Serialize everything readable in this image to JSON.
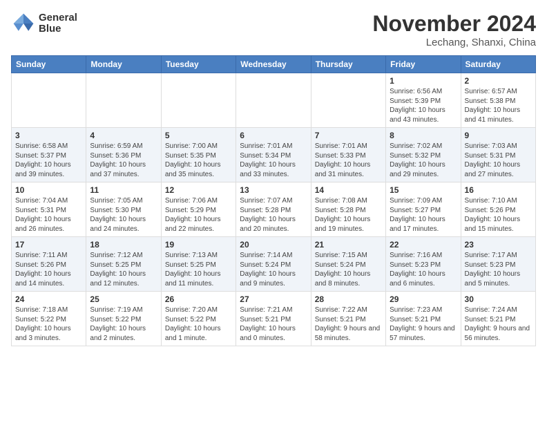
{
  "header": {
    "logo_line1": "General",
    "logo_line2": "Blue",
    "month": "November 2024",
    "location": "Lechang, Shanxi, China"
  },
  "weekdays": [
    "Sunday",
    "Monday",
    "Tuesday",
    "Wednesday",
    "Thursday",
    "Friday",
    "Saturday"
  ],
  "weeks": [
    [
      {
        "day": "",
        "info": ""
      },
      {
        "day": "",
        "info": ""
      },
      {
        "day": "",
        "info": ""
      },
      {
        "day": "",
        "info": ""
      },
      {
        "day": "",
        "info": ""
      },
      {
        "day": "1",
        "info": "Sunrise: 6:56 AM\nSunset: 5:39 PM\nDaylight: 10 hours and 43 minutes."
      },
      {
        "day": "2",
        "info": "Sunrise: 6:57 AM\nSunset: 5:38 PM\nDaylight: 10 hours and 41 minutes."
      }
    ],
    [
      {
        "day": "3",
        "info": "Sunrise: 6:58 AM\nSunset: 5:37 PM\nDaylight: 10 hours and 39 minutes."
      },
      {
        "day": "4",
        "info": "Sunrise: 6:59 AM\nSunset: 5:36 PM\nDaylight: 10 hours and 37 minutes."
      },
      {
        "day": "5",
        "info": "Sunrise: 7:00 AM\nSunset: 5:35 PM\nDaylight: 10 hours and 35 minutes."
      },
      {
        "day": "6",
        "info": "Sunrise: 7:01 AM\nSunset: 5:34 PM\nDaylight: 10 hours and 33 minutes."
      },
      {
        "day": "7",
        "info": "Sunrise: 7:01 AM\nSunset: 5:33 PM\nDaylight: 10 hours and 31 minutes."
      },
      {
        "day": "8",
        "info": "Sunrise: 7:02 AM\nSunset: 5:32 PM\nDaylight: 10 hours and 29 minutes."
      },
      {
        "day": "9",
        "info": "Sunrise: 7:03 AM\nSunset: 5:31 PM\nDaylight: 10 hours and 27 minutes."
      }
    ],
    [
      {
        "day": "10",
        "info": "Sunrise: 7:04 AM\nSunset: 5:31 PM\nDaylight: 10 hours and 26 minutes."
      },
      {
        "day": "11",
        "info": "Sunrise: 7:05 AM\nSunset: 5:30 PM\nDaylight: 10 hours and 24 minutes."
      },
      {
        "day": "12",
        "info": "Sunrise: 7:06 AM\nSunset: 5:29 PM\nDaylight: 10 hours and 22 minutes."
      },
      {
        "day": "13",
        "info": "Sunrise: 7:07 AM\nSunset: 5:28 PM\nDaylight: 10 hours and 20 minutes."
      },
      {
        "day": "14",
        "info": "Sunrise: 7:08 AM\nSunset: 5:28 PM\nDaylight: 10 hours and 19 minutes."
      },
      {
        "day": "15",
        "info": "Sunrise: 7:09 AM\nSunset: 5:27 PM\nDaylight: 10 hours and 17 minutes."
      },
      {
        "day": "16",
        "info": "Sunrise: 7:10 AM\nSunset: 5:26 PM\nDaylight: 10 hours and 15 minutes."
      }
    ],
    [
      {
        "day": "17",
        "info": "Sunrise: 7:11 AM\nSunset: 5:26 PM\nDaylight: 10 hours and 14 minutes."
      },
      {
        "day": "18",
        "info": "Sunrise: 7:12 AM\nSunset: 5:25 PM\nDaylight: 10 hours and 12 minutes."
      },
      {
        "day": "19",
        "info": "Sunrise: 7:13 AM\nSunset: 5:25 PM\nDaylight: 10 hours and 11 minutes."
      },
      {
        "day": "20",
        "info": "Sunrise: 7:14 AM\nSunset: 5:24 PM\nDaylight: 10 hours and 9 minutes."
      },
      {
        "day": "21",
        "info": "Sunrise: 7:15 AM\nSunset: 5:24 PM\nDaylight: 10 hours and 8 minutes."
      },
      {
        "day": "22",
        "info": "Sunrise: 7:16 AM\nSunset: 5:23 PM\nDaylight: 10 hours and 6 minutes."
      },
      {
        "day": "23",
        "info": "Sunrise: 7:17 AM\nSunset: 5:23 PM\nDaylight: 10 hours and 5 minutes."
      }
    ],
    [
      {
        "day": "24",
        "info": "Sunrise: 7:18 AM\nSunset: 5:22 PM\nDaylight: 10 hours and 3 minutes."
      },
      {
        "day": "25",
        "info": "Sunrise: 7:19 AM\nSunset: 5:22 PM\nDaylight: 10 hours and 2 minutes."
      },
      {
        "day": "26",
        "info": "Sunrise: 7:20 AM\nSunset: 5:22 PM\nDaylight: 10 hours and 1 minute."
      },
      {
        "day": "27",
        "info": "Sunrise: 7:21 AM\nSunset: 5:21 PM\nDaylight: 10 hours and 0 minutes."
      },
      {
        "day": "28",
        "info": "Sunrise: 7:22 AM\nSunset: 5:21 PM\nDaylight: 9 hours and 58 minutes."
      },
      {
        "day": "29",
        "info": "Sunrise: 7:23 AM\nSunset: 5:21 PM\nDaylight: 9 hours and 57 minutes."
      },
      {
        "day": "30",
        "info": "Sunrise: 7:24 AM\nSunset: 5:21 PM\nDaylight: 9 hours and 56 minutes."
      }
    ]
  ]
}
